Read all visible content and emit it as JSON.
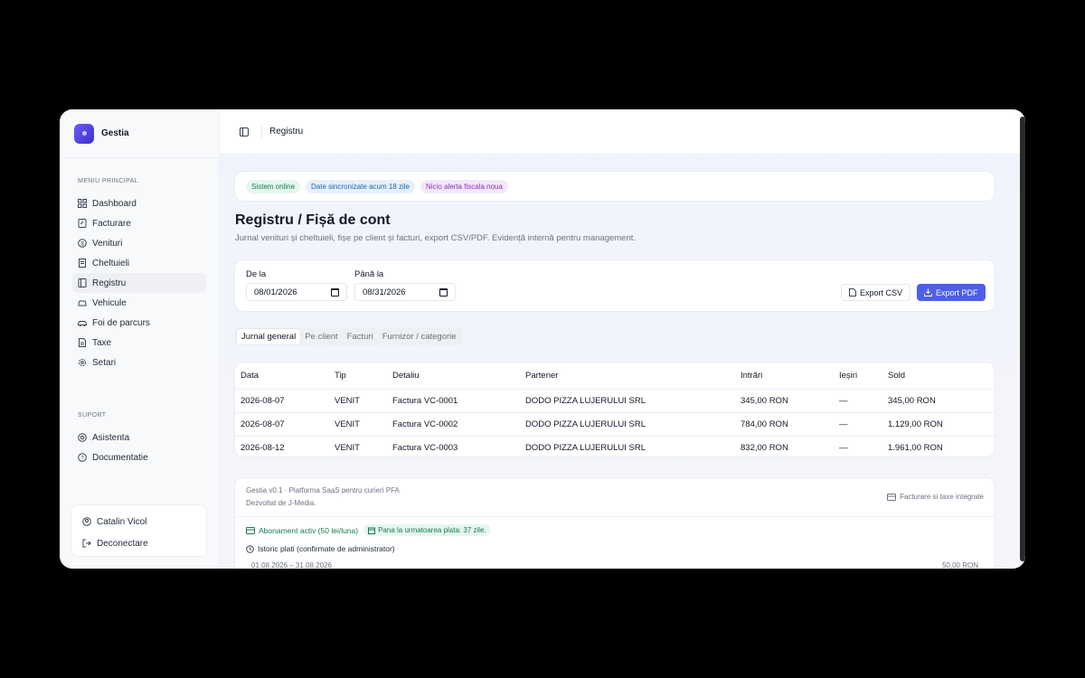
{
  "app": {
    "name": "Gestia"
  },
  "sidebar": {
    "main_label": "MENIU PRINCIPAL",
    "items": [
      {
        "label": "Dashboard",
        "icon": "grid-icon"
      },
      {
        "label": "Facturare",
        "icon": "file-edit-icon"
      },
      {
        "label": "Venituri",
        "icon": "dollar-circle-icon"
      },
      {
        "label": "Cheltuieli",
        "icon": "receipt-icon"
      },
      {
        "label": "Registru",
        "icon": "book-icon"
      },
      {
        "label": "Vehicule",
        "icon": "car-icon"
      },
      {
        "label": "Foi de parcurs",
        "icon": "car-front-icon"
      },
      {
        "label": "Taxe",
        "icon": "document-icon"
      },
      {
        "label": "Setari",
        "icon": "gear-icon"
      }
    ],
    "support_label": "SUPORT",
    "support_items": [
      {
        "label": "Asistenta",
        "icon": "lifebuoy-icon"
      },
      {
        "label": "Documentatie",
        "icon": "help-circle-icon"
      }
    ],
    "user": {
      "name": "Catalin Vicol",
      "logout": "Deconectare"
    }
  },
  "topbar": {
    "breadcrumb": "Registru"
  },
  "status": {
    "online": "Sistem online",
    "sync": "Date sincronizate acum 18 zile",
    "alert": "Nicio alerta fiscala noua"
  },
  "page": {
    "title": "Registru / Fișă de cont",
    "subtitle": "Jurnal venituri și cheltuieli, fișe pe client și facturi, export CSV/PDF. Evidență internă pentru management."
  },
  "filters": {
    "from_label": "De la",
    "from_value": "08/01/2026",
    "to_label": "Până la",
    "to_value": "08/31/2026",
    "export_csv": "Export CSV",
    "export_pdf": "Export PDF"
  },
  "tabs": [
    "Jurnal general",
    "Pe client",
    "Facturi",
    "Furnizor / categorie"
  ],
  "table": {
    "headers": [
      "Data",
      "Tip",
      "Detaliu",
      "Partener",
      "Intrări",
      "Ieșiri",
      "Sold"
    ],
    "rows": [
      [
        "2026-08-07",
        "VENIT",
        "Factura VC-0001",
        "DODO PIZZA LUJERULUI SRL",
        "345,00 RON",
        "—",
        "345,00 RON"
      ],
      [
        "2026-08-07",
        "VENIT",
        "Factura VC-0002",
        "DODO PIZZA LUJERULUI SRL",
        "784,00 RON",
        "—",
        "1.129,00 RON"
      ],
      [
        "2026-08-12",
        "VENIT",
        "Factura VC-0003",
        "DODO PIZZA LUJERULUI SRL",
        "832,00 RON",
        "—",
        "1.961,00 RON"
      ]
    ]
  },
  "footer": {
    "version": "Gestia v0.1 · Platforma SaaS pentru curieri PFA",
    "dev": "Dezvoltat de J-Media.",
    "integrated": "Facturare si taxe integrate",
    "subscription": "Abonament activ (50 lei/luna)",
    "next_payment": "Pana la urmatoarea plata: 37 zile.",
    "history": "Istoric plati (confirmate de administrator)",
    "history_period": "01.08.2026 – 31.08.2026",
    "history_amount": "50,00 RON"
  }
}
